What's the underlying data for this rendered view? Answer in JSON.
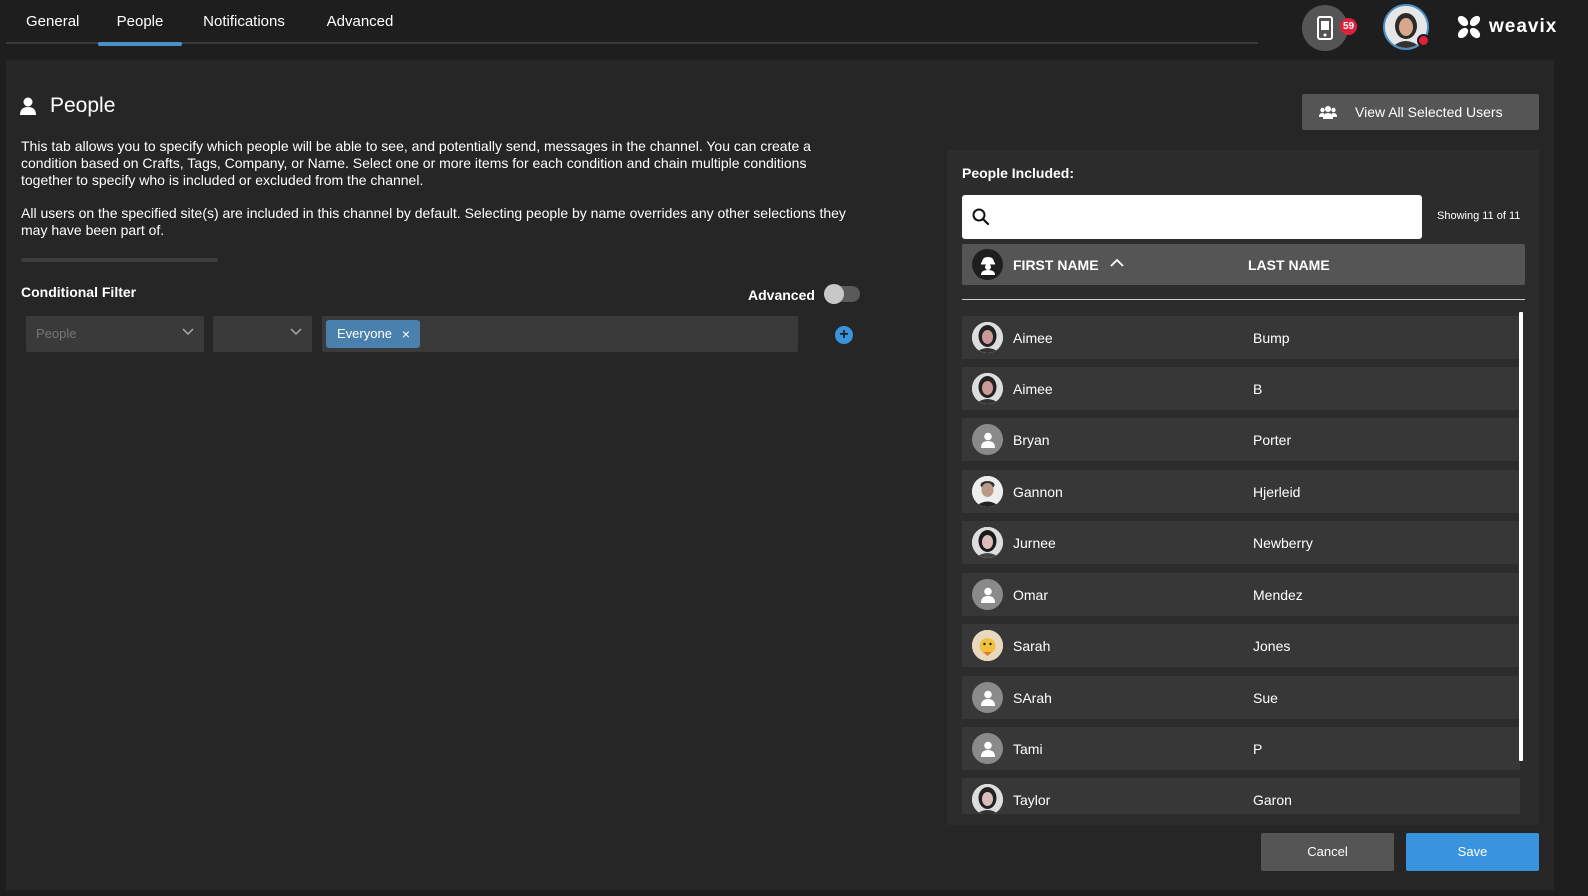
{
  "tabs": [
    {
      "label": "General"
    },
    {
      "label": "People",
      "active": true
    },
    {
      "label": "Notifications"
    },
    {
      "label": "Advanced"
    }
  ],
  "header": {
    "device_badge": "59",
    "logo_text": "weavix",
    "device_icon": "mobile-device-icon"
  },
  "page": {
    "title": "People",
    "description_1": "This tab allows you to specify which people will be able to see, and potentially send, messages in the channel. You can create a condition based on Crafts, Tags, Company, or Name. Select one or more items for each condition and chain multiple conditions together to specify who is included or excluded from the channel.",
    "description_2": "All users on the specified site(s) are included in this channel by default. Selecting people by name overrides any other selections they may have been part of."
  },
  "filter": {
    "label": "Conditional Filter",
    "advanced_label": "Advanced",
    "advanced_on": false,
    "select_1": "People",
    "select_2": "",
    "chip": "Everyone",
    "chip_remove": "×",
    "add": "+"
  },
  "view_all_label": "View All Selected Users",
  "list": {
    "label": "People Included:",
    "search_placeholder": "",
    "showing": "Showing 11 of 11",
    "col_first": "FIRST NAME",
    "col_last": "LAST NAME",
    "rows": [
      {
        "first": "Aimee",
        "last": "Bump",
        "photo": true
      },
      {
        "first": "Aimee",
        "last": "B",
        "photo": true
      },
      {
        "first": "Bryan",
        "last": "Porter",
        "photo": false
      },
      {
        "first": "Gannon",
        "last": "Hjerleid",
        "photo": true
      },
      {
        "first": "Jurnee",
        "last": "Newberry",
        "photo": true
      },
      {
        "first": "Omar",
        "last": "Mendez",
        "photo": false
      },
      {
        "first": "Sarah",
        "last": "Jones",
        "photo": true
      },
      {
        "first": "SArah",
        "last": "Sue",
        "photo": false
      },
      {
        "first": "Tami",
        "last": "P",
        "photo": false
      },
      {
        "first": "Taylor",
        "last": "Garon",
        "photo": true
      }
    ]
  },
  "footer": {
    "cancel": "Cancel",
    "save": "Save"
  },
  "colors": {
    "accent": "#3a94dd",
    "tab_indicator": "#4a90c8",
    "chip": "#4a80ad",
    "badge": "#e0203c"
  }
}
